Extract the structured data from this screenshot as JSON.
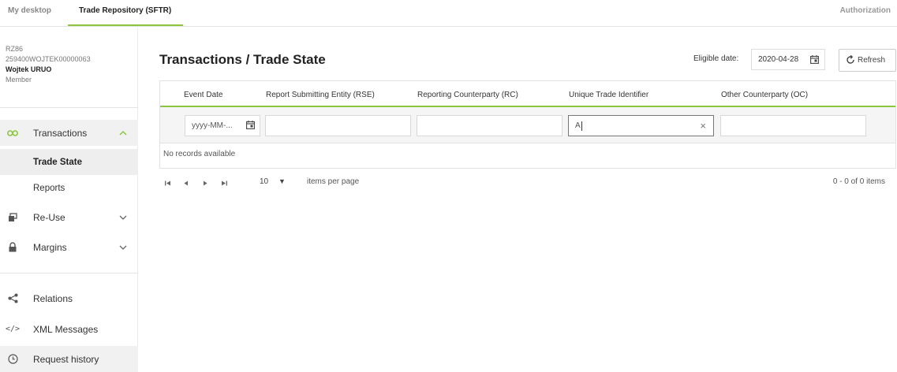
{
  "topnav": {
    "tabs": [
      "My desktop",
      "Trade Repository (SFTR)"
    ],
    "right_label": "Authorization"
  },
  "member": {
    "code": "RZ86",
    "lei": "259400WOJTEK00000063",
    "name": "Wojtek URUO",
    "role": "Member"
  },
  "sidebar": {
    "transactions": "Transactions",
    "trade_state": "Trade State",
    "reports": "Reports",
    "reuse": "Re-Use",
    "margins": "Margins",
    "relations": "Relations",
    "xml_messages": "XML Messages",
    "request_history": "Request history"
  },
  "page": {
    "title": "Transactions / Trade State",
    "eligible_label": "Eligible date:",
    "eligible_value": "2020-04-28",
    "refresh_label": "Refresh"
  },
  "grid": {
    "columns": [
      "Event Date",
      "Report Submitting Entity (RSE)",
      "Reporting Counterparty (RC)",
      "Unique Trade Identifier",
      "Other Counterparty (OC)"
    ],
    "filters": {
      "event_date_placeholder": "yyyy-MM-...",
      "rse": "",
      "rc": "",
      "uti": "A",
      "oc": ""
    },
    "no_records": "No records available"
  },
  "pager": {
    "page_size": "10",
    "items_per_page": "items per page",
    "info": "0 - 0 of 0 items"
  },
  "colors": {
    "accent": "#8cc63f"
  }
}
